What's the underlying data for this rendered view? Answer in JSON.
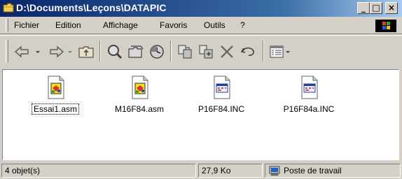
{
  "window": {
    "title": "D:\\Documents\\Leçons\\DATAPIC",
    "minimize": "_",
    "maximize": "□",
    "close": "×"
  },
  "menu": {
    "items": [
      {
        "label": "Fichier"
      },
      {
        "label": "Edition"
      },
      {
        "label": "Affichage"
      },
      {
        "label": "Favoris"
      },
      {
        "label": "Outils"
      },
      {
        "label": "?"
      }
    ]
  },
  "toolbar": {
    "buttons": [
      {
        "icon": "back-icon"
      },
      {
        "icon": "forward-icon"
      },
      {
        "icon": "up-folder-icon"
      },
      {
        "icon": "search-icon"
      },
      {
        "icon": "folders-icon"
      },
      {
        "icon": "history-icon"
      },
      {
        "icon": "move-to-icon"
      },
      {
        "icon": "copy-to-icon"
      },
      {
        "icon": "delete-icon"
      },
      {
        "icon": "undo-icon"
      },
      {
        "icon": "views-icon"
      }
    ]
  },
  "files": [
    {
      "name": "Essai1.asm",
      "type": "asm",
      "selected": true
    },
    {
      "name": "M16F84.asm",
      "type": "asm",
      "selected": false
    },
    {
      "name": "P16F84.INC",
      "type": "inc",
      "selected": false
    },
    {
      "name": "P16F84a.INC",
      "type": "inc",
      "selected": false
    }
  ],
  "status": {
    "count": "4 objet(s)",
    "size": "27,9 Ko",
    "zone": "Poste de travail"
  }
}
